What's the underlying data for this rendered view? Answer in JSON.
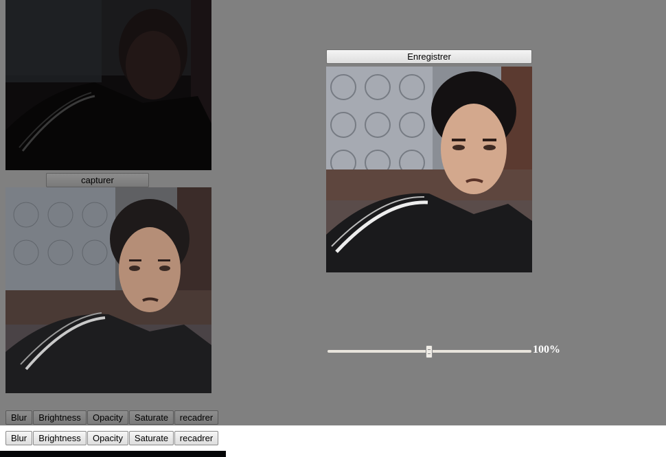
{
  "buttons": {
    "capture": "capturer",
    "save": "Enregistrer"
  },
  "filters_toolbar_1": [
    "Blur",
    "Brightness",
    "Opacity",
    "Saturate",
    "recadrer"
  ],
  "filters_toolbar_2": [
    "Blur",
    "Brightness",
    "Opacity",
    "Saturate",
    "recadrer"
  ],
  "zoom": {
    "label": "100%",
    "value_percent": 100
  },
  "colors": {
    "page_background": "#808080",
    "lower_background": "#ffffff"
  }
}
